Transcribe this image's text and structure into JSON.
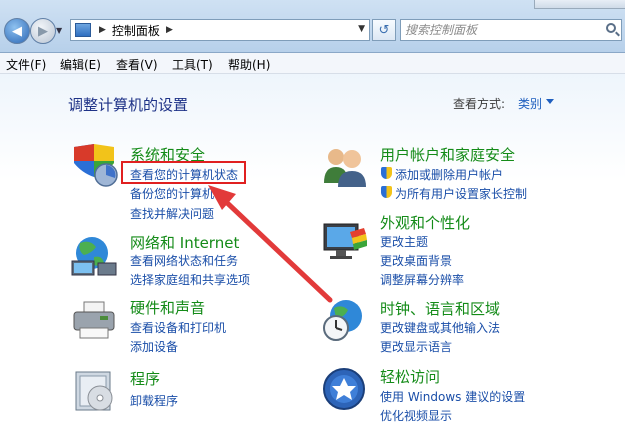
{
  "window": {
    "address_path": "控制面板",
    "search_placeholder": "搜索控制面板"
  },
  "menu": [
    "文件(F)",
    "编辑(E)",
    "查看(V)",
    "工具(T)",
    "帮助(H)"
  ],
  "header": {
    "title": "调整计算机的设置",
    "view_by_label": "查看方式:",
    "view_by_value": "类别"
  },
  "categories": [
    {
      "title": "系统和安全",
      "links": [
        "查看您的计算机状态",
        "备份您的计算机",
        "查找并解决问题"
      ]
    },
    {
      "title": "网络和 Internet",
      "links": [
        "查看网络状态和任务",
        "选择家庭组和共享选项"
      ]
    },
    {
      "title": "硬件和声音",
      "links": [
        "查看设备和打印机",
        "添加设备"
      ]
    },
    {
      "title": "程序",
      "links": [
        "卸载程序"
      ]
    },
    {
      "title": "用户帐户和家庭安全",
      "links": [
        "添加或删除用户帐户",
        "为所有用户设置家长控制"
      ]
    },
    {
      "title": "外观和个性化",
      "links": [
        "更改主题",
        "更改桌面背景",
        "调整屏幕分辨率"
      ]
    },
    {
      "title": "时钟、语言和区域",
      "links": [
        "更改键盘或其他输入法",
        "更改显示语言"
      ]
    },
    {
      "title": "轻松访问",
      "links": [
        "使用 Windows 建议的设置",
        "优化视频显示"
      ]
    }
  ],
  "colors": {
    "category_title": "#148b18",
    "link": "#1a4ea8",
    "heading": "#1e3287",
    "highlight": "#e02020"
  }
}
